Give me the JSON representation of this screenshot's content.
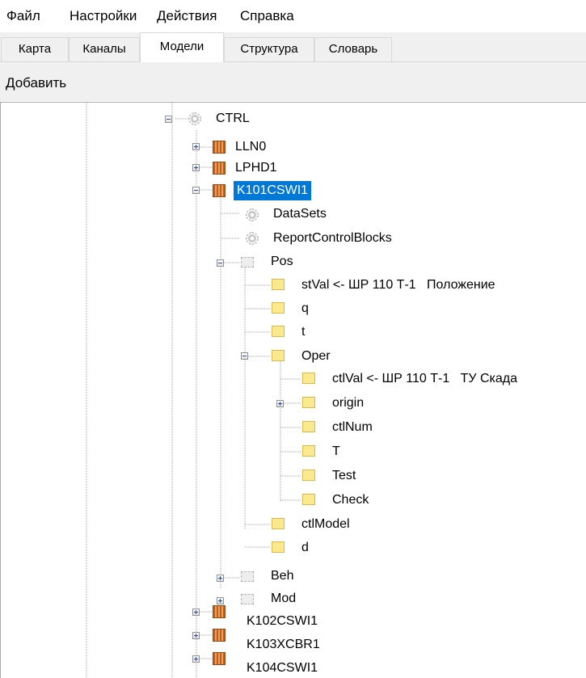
{
  "menu": {
    "file": "Файл",
    "settings": "Настройки",
    "actions": "Действия",
    "help": "Справка"
  },
  "tabs": [
    "Карта",
    "Каналы",
    "Модели",
    "Структура",
    "Словарь"
  ],
  "active_tab": "Модели",
  "toolbar": {
    "add": "Добавить"
  },
  "tree": {
    "ctrl": "CTRL",
    "lln0": "LLN0",
    "lphd1": "LPHD1",
    "k101": "K101CSWI1",
    "datasets": "DataSets",
    "rcb": "ReportControlBlocks",
    "pos": "Pos",
    "stval": "stVal <- ШР 110 Т-1   Положение",
    "q": "q",
    "t": "t",
    "oper": "Oper",
    "ctlval": "ctlVal <- ШР 110 Т-1   ТУ Скада",
    "origin": "origin",
    "ctlnum": "ctlNum",
    "T": "T",
    "test": "Test",
    "check": "Check",
    "ctlmodel": "ctlModel",
    "d": "d",
    "beh": "Beh",
    "mod": "Mod",
    "k102": "K102CSWI1",
    "k103": "K103XCBR1",
    "k104": "K104CSWI1"
  }
}
